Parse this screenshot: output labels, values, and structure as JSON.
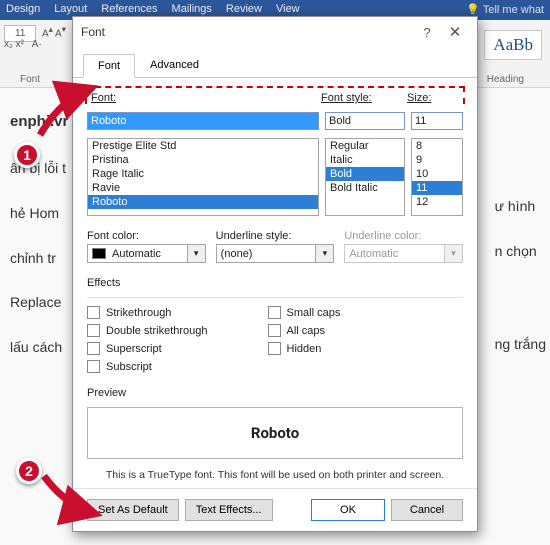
{
  "bg": {
    "tabs": [
      "Design",
      "Layout",
      "References",
      "Mailings",
      "Review",
      "View"
    ],
    "tell": "Tell me what",
    "fontsize": "11",
    "style_a": "AaBb",
    "style_b": "AaBb",
    "group1": "Font",
    "group2": "Heading",
    "doc_lines": [
      "enphi.vr",
      "ân bị lỗi t",
      "hẻ Hom",
      "chỉnh tr",
      "Replace",
      "lấu cách"
    ],
    "doc_tails": [
      "",
      "",
      "",
      "",
      "ư hình",
      "n chọn",
      "ng trắng",
      ""
    ]
  },
  "dialog": {
    "title": "Font",
    "tabs": {
      "font": "Font",
      "advanced": "Advanced"
    },
    "labels": {
      "font": "Font:",
      "style": "Font style:",
      "size": "Size:"
    },
    "font_input": "Roboto",
    "style_input": "Bold",
    "size_input": "11",
    "font_list": [
      "Prestige Elite Std",
      "Pristina",
      "Rage Italic",
      "Ravie",
      "Roboto"
    ],
    "style_list": [
      "Regular",
      "Italic",
      "Bold",
      "Bold Italic"
    ],
    "size_list": [
      "8",
      "9",
      "10",
      "11",
      "12"
    ],
    "font_color_lbl": "Font color:",
    "font_color_val": "Automatic",
    "underline_lbl": "Underline style:",
    "underline_val": "(none)",
    "ucolor_lbl": "Underline color:",
    "ucolor_val": "Automatic",
    "effects_lbl": "Effects",
    "effects_left": [
      "Strikethrough",
      "Double strikethrough",
      "Superscript",
      "Subscript"
    ],
    "effects_right": [
      "Small caps",
      "All caps",
      "Hidden"
    ],
    "preview_lbl": "Preview",
    "preview_text": "Roboto",
    "preview_note": "This is a TrueType font. This font will be used on both printer and screen.",
    "btns": {
      "default": "Set As Default",
      "effects": "Text Effects...",
      "ok": "OK",
      "cancel": "Cancel"
    }
  },
  "annotations": {
    "a1": "1",
    "a2": "2"
  }
}
